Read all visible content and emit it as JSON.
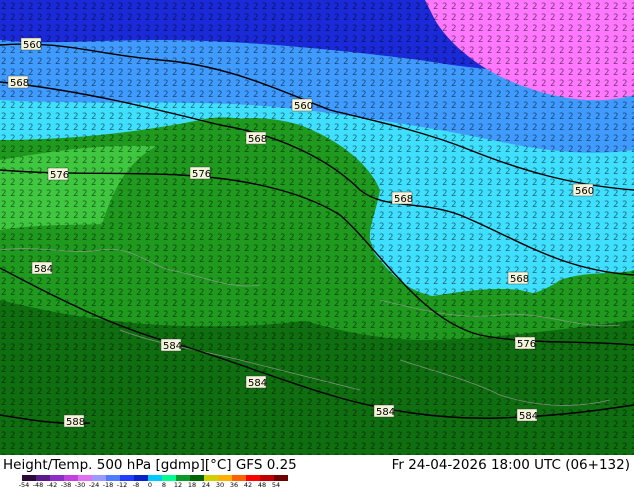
{
  "footer": {
    "left_title": "Height/Temp. 500 hPa [gdmp][°C] GFS 0.25",
    "right_title": "Fr 24-04-2026 18:00 UTC (06+132)"
  },
  "colorbar": {
    "ticks": [
      "-54",
      "-48",
      "-42",
      "-38",
      "-30",
      "-24",
      "-18",
      "-12",
      "-8",
      "0",
      "8",
      "12",
      "18",
      "24",
      "30",
      "36",
      "42",
      "48",
      "54"
    ],
    "colors": [
      "#2b0a3a",
      "#5a1a8a",
      "#8e2cc8",
      "#c040e0",
      "#e070f0",
      "#9a9aff",
      "#4f7cff",
      "#1f3cff",
      "#0a23c8",
      "#00c8ff",
      "#00ff90",
      "#0a9a2a",
      "#006400",
      "#d0d000",
      "#ffb000",
      "#ff6000",
      "#ff0000",
      "#c00000",
      "#700000"
    ]
  },
  "map": {
    "colors": {
      "deep_blue": "#1a2ad8",
      "light_blue": "#3f9bff",
      "cyan": "#3fe0ff",
      "light_green": "#3fc83f",
      "green": "#1f9a1f",
      "dark_green": "#0f6e0f",
      "magenta": "#ff78ff",
      "coast": "#9a9a9a"
    },
    "contour_labels": [
      {
        "id": "l1",
        "text": "560"
      },
      {
        "id": "l2",
        "text": "568"
      },
      {
        "id": "l3",
        "text": "560"
      },
      {
        "id": "l4",
        "text": "568"
      },
      {
        "id": "l5",
        "text": "576"
      },
      {
        "id": "l6",
        "text": "576"
      },
      {
        "id": "l7",
        "text": "568"
      },
      {
        "id": "l8",
        "text": "560"
      },
      {
        "id": "l9",
        "text": "584"
      },
      {
        "id": "l10",
        "text": "568"
      },
      {
        "id": "l11",
        "text": "576"
      },
      {
        "id": "l12",
        "text": "584"
      },
      {
        "id": "l13",
        "text": "584"
      },
      {
        "id": "l14",
        "text": "584"
      },
      {
        "id": "l15",
        "text": "584"
      },
      {
        "id": "l16",
        "text": "588"
      }
    ]
  }
}
